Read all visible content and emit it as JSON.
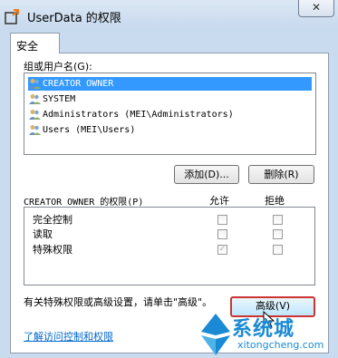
{
  "window": {
    "title": "UserData 的权限",
    "close_label": "✕"
  },
  "tabs": [
    {
      "label": "安全"
    }
  ],
  "users_section": {
    "label": "组或用户名(G):",
    "users": [
      {
        "name": "CREATOR OWNER",
        "selected": true
      },
      {
        "name": "SYSTEM",
        "selected": false
      },
      {
        "name": "Administrators (MEI\\Administrators)",
        "selected": false
      },
      {
        "name": "Users (MEI\\Users)",
        "selected": false
      }
    ],
    "add_button": "添加(D)...",
    "remove_button": "删除(R)"
  },
  "permissions": {
    "label": "CREATOR OWNER 的权限(P)",
    "allow_header": "允许",
    "deny_header": "拒绝",
    "rows": [
      {
        "name": "完全控制",
        "allow": false,
        "deny": false
      },
      {
        "name": "读取",
        "allow": false,
        "deny": false
      },
      {
        "name": "特殊权限",
        "allow": true,
        "deny": false
      }
    ]
  },
  "advanced": {
    "info_text": "有关特殊权限或高级设置，请单击\"高级\"。",
    "button_label": "高级(V)"
  },
  "help_link": "了解访问控制和权限",
  "watermark": {
    "brand": "系统城",
    "domain": "xitongcheng.com",
    "color": "#1a8ad4"
  },
  "colors": {
    "selection": "#3399ff",
    "link": "#0066cc"
  }
}
